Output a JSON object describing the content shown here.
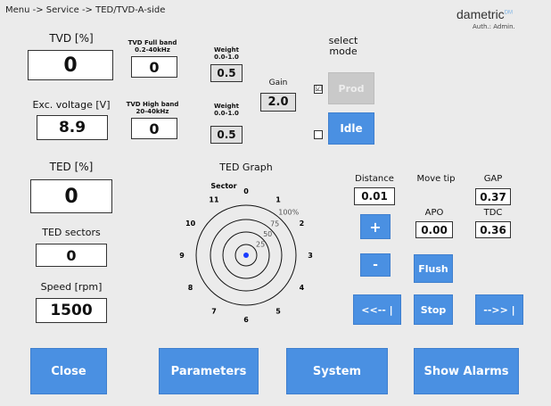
{
  "breadcrumb": "Menu -> Service -> TED/TVD-A-side",
  "brand": {
    "name": "dametric",
    "mark": "DM",
    "auth": "Auth.: Admin."
  },
  "tvd": {
    "label": "TVD [%]",
    "value": "0"
  },
  "exc": {
    "label": "Exc. voltage [V]",
    "value": "8.9"
  },
  "tvd_full": {
    "label_1": "TVD Full band",
    "label_2": "0.2-40kHz",
    "value": "0"
  },
  "tvd_high": {
    "label_1": "TVD High band",
    "label_2": "20-40kHz",
    "value": "0"
  },
  "weight_1": {
    "label_1": "Weight",
    "label_2": "0.0-1.0",
    "value": "0.5"
  },
  "weight_2": {
    "label_1": "Weight",
    "label_2": "0.0-1.0",
    "value": "0.5"
  },
  "gain": {
    "label": "Gain",
    "value": "2.0"
  },
  "mode": {
    "label_1": "select",
    "label_2": "mode",
    "prod_label": "Prod",
    "idle_label": "Idle",
    "prod_checked": true,
    "idle_checked": false,
    "check_glyph": "☑"
  },
  "ted": {
    "label": "TED [%]",
    "value": "0"
  },
  "ted_sectors": {
    "label": "TED sectors",
    "value": "0"
  },
  "speed": {
    "label": "Speed [rpm]",
    "value": "1500"
  },
  "graph": {
    "title": "TED Graph",
    "sector_label": "Sector",
    "sectors": [
      "0",
      "1",
      "2",
      "3",
      "4",
      "5",
      "6",
      "7",
      "8",
      "9",
      "10",
      "11"
    ],
    "rings": [
      "25",
      "50",
      "75",
      "100%"
    ],
    "point_value": 0
  },
  "distance": {
    "label": "Distance",
    "value": "0.01"
  },
  "move_tip": {
    "label": "Move tip"
  },
  "gap": {
    "label": "GAP",
    "value": "0.37"
  },
  "apo": {
    "label": "APO",
    "value": "0.00"
  },
  "tdc": {
    "label": "TDC",
    "value": "0.36"
  },
  "buttons": {
    "plus": "+",
    "minus": "-",
    "flush": "Flush",
    "back": "<<-- |",
    "stop": "Stop",
    "fwd": "-->> |"
  },
  "bottom": {
    "close": "Close",
    "parameters": "Parameters",
    "system": "System",
    "alarms": "Show Alarms"
  },
  "colors": {
    "button_blue": "#4a90e2",
    "disabled": "#c9c9c9",
    "point": "#1a3cff"
  }
}
